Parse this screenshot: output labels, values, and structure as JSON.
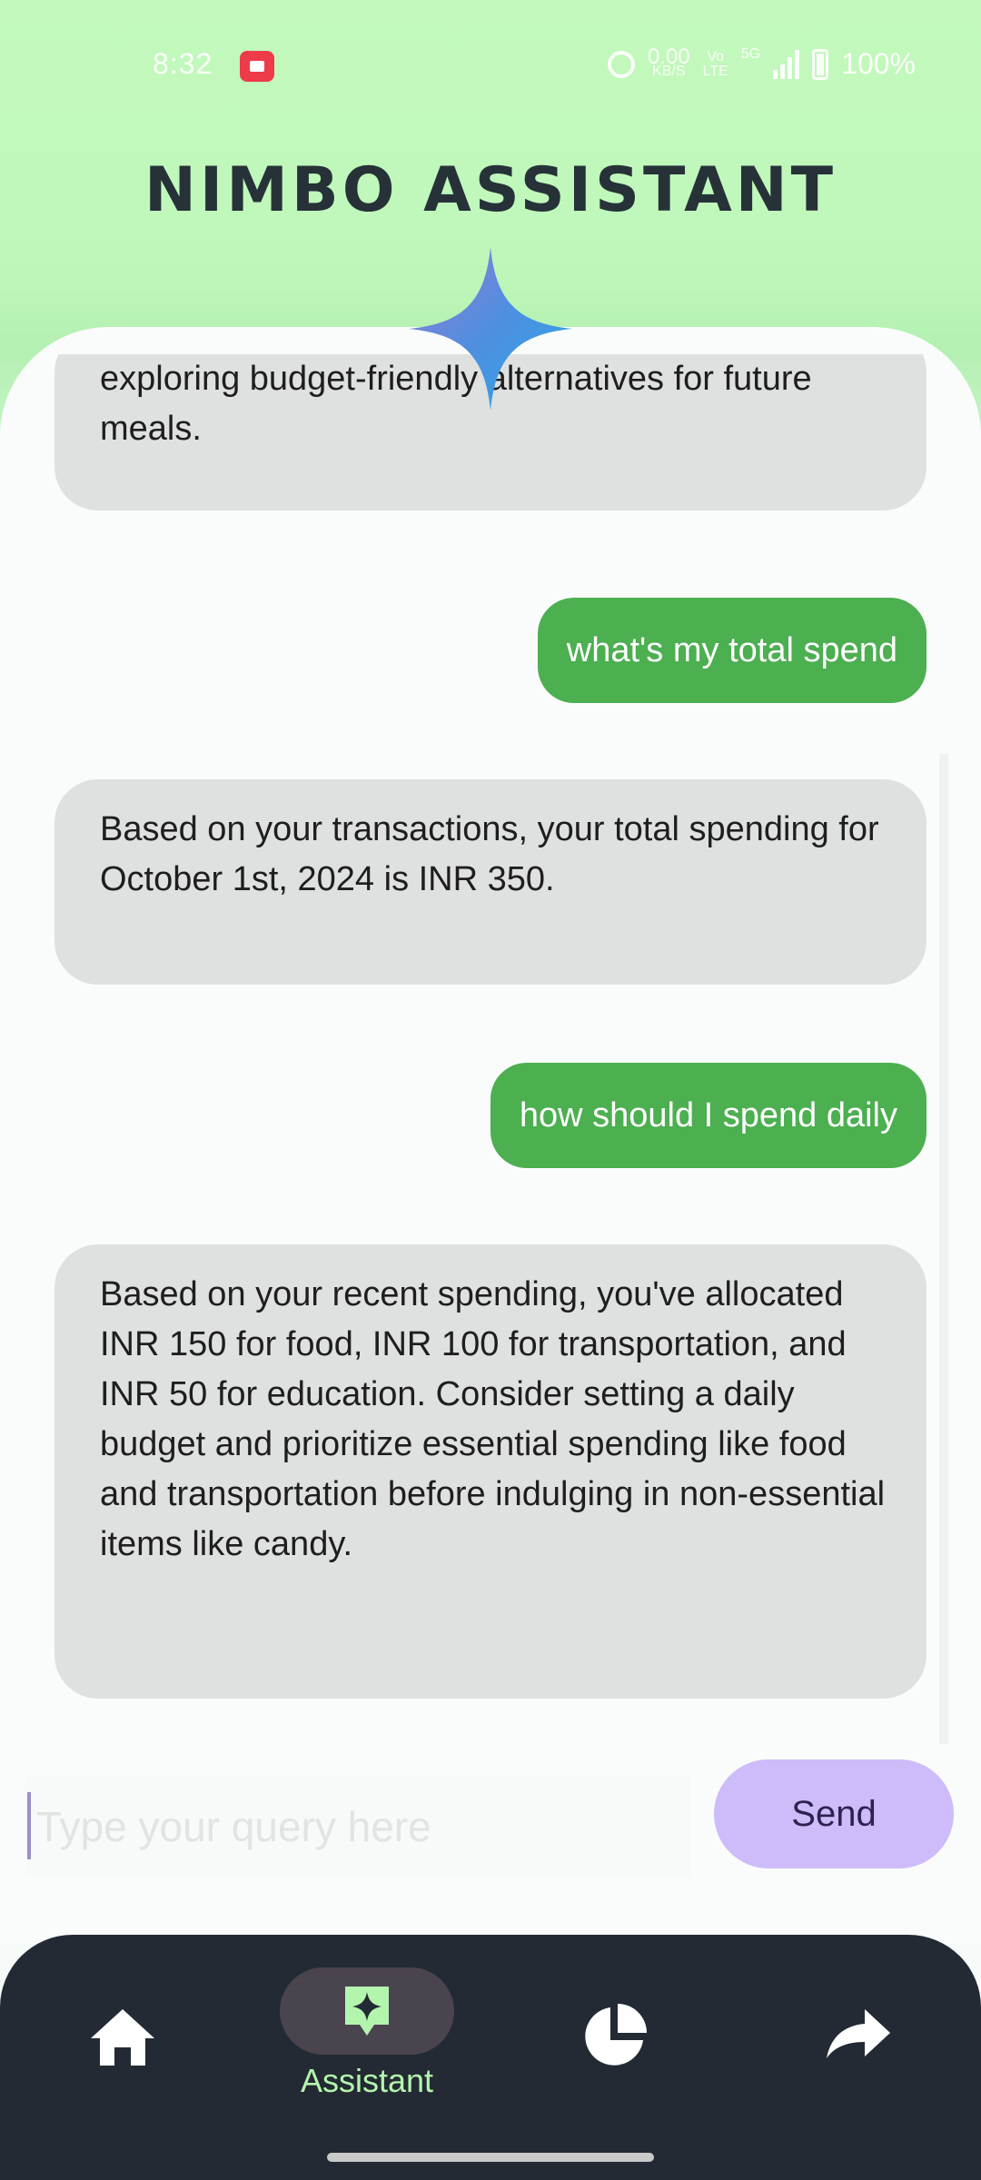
{
  "status_bar": {
    "time": "8:32",
    "network_speed_value": "0.00",
    "network_speed_unit": "KB/S",
    "volte_top": "Vo",
    "volte_bottom": "LTE",
    "network_type": "5G",
    "battery": "100%"
  },
  "header": {
    "title": "NIMBO ASSISTANT"
  },
  "chat": {
    "messages": [
      {
        "role": "assistant",
        "text": "exploring budget-friendly alternatives for future meals."
      },
      {
        "role": "user",
        "text": "what's my total spend"
      },
      {
        "role": "assistant",
        "text": "Based on your transactions, your total spending for October 1st, 2024 is INR 350."
      },
      {
        "role": "user",
        "text": "how should I spend daily"
      },
      {
        "role": "assistant",
        "text": "Based on your recent spending, you've allocated INR 150 for food, INR 100 for transportation, and INR 50 for education. Consider setting a daily budget and prioritize essential spending like food and transportation before indulging in non-essential items like candy."
      }
    ]
  },
  "composer": {
    "placeholder": "Type your query here",
    "value": "",
    "send_label": "Send"
  },
  "bottom_nav": {
    "items": [
      {
        "icon": "home-icon"
      },
      {
        "icon": "assistant-sparkle-icon",
        "label": "Assistant",
        "active": true
      },
      {
        "icon": "pie-chart-icon"
      },
      {
        "icon": "share-arrow-icon"
      }
    ]
  },
  "colors": {
    "user_bubble": "#4caf50",
    "assistant_bubble": "#dfe1e0",
    "send_button": "#cdbcf9",
    "nav_background": "#232a33",
    "nav_active_label": "#b3f5ad",
    "header_gradient_top": "#c3f9bd"
  }
}
